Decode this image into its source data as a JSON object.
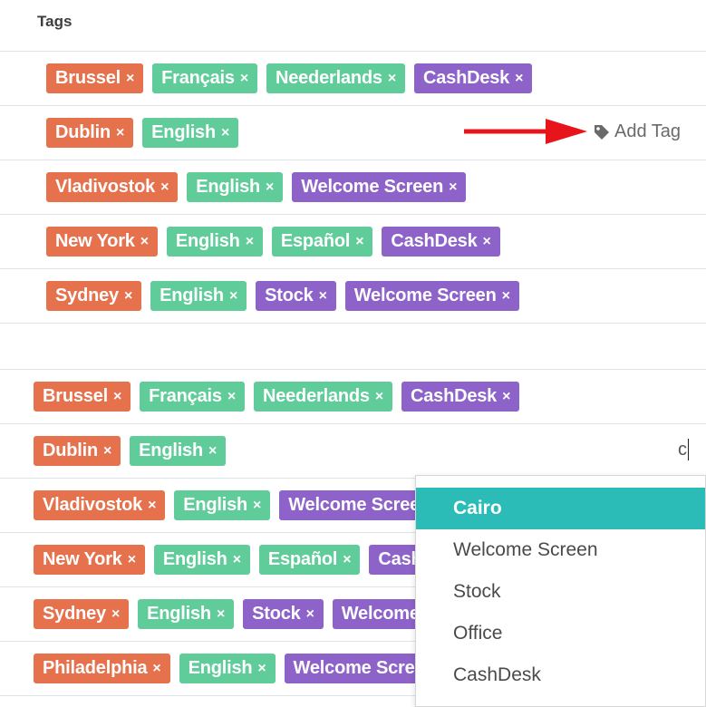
{
  "header": {
    "title": "Tags"
  },
  "top_rows": [
    {
      "tags": [
        {
          "label": "Brussel",
          "x": "×"
        },
        {
          "label": "Français",
          "x": "×"
        },
        {
          "label": "Neederlands",
          "x": "×"
        },
        {
          "label": "CashDesk",
          "x": "×"
        }
      ]
    },
    {
      "tags": [
        {
          "label": "Dublin",
          "x": "×"
        },
        {
          "label": "English",
          "x": "×"
        }
      ]
    },
    {
      "tags": [
        {
          "label": "Vladivostok",
          "x": "×"
        },
        {
          "label": "English",
          "x": "×"
        },
        {
          "label": "Welcome Screen",
          "x": "×"
        }
      ]
    },
    {
      "tags": [
        {
          "label": "New York",
          "x": "×"
        },
        {
          "label": "English",
          "x": "×"
        },
        {
          "label": "Español",
          "x": "×"
        },
        {
          "label": "CashDesk",
          "x": "×"
        }
      ]
    },
    {
      "tags": [
        {
          "label": "Sydney",
          "x": "×"
        },
        {
          "label": "English",
          "x": "×"
        },
        {
          "label": "Stock",
          "x": "×"
        },
        {
          "label": "Welcome Screen",
          "x": "×"
        }
      ]
    }
  ],
  "add_tag": {
    "label": "Add Tag",
    "icon": "tag-icon"
  },
  "bottom_rows": [
    {
      "tags": [
        {
          "label": "Brussel",
          "x": "×"
        },
        {
          "label": "Français",
          "x": "×"
        },
        {
          "label": "Neederlands",
          "x": "×"
        },
        {
          "label": "CashDesk",
          "x": "×"
        }
      ]
    },
    {
      "tags": [
        {
          "label": "Dublin",
          "x": "×"
        },
        {
          "label": "English",
          "x": "×"
        }
      ]
    },
    {
      "tags": [
        {
          "label": "Vladivostok",
          "x": "×"
        },
        {
          "label": "English",
          "x": "×"
        },
        {
          "label": "Welcome Screen",
          "x": "×"
        }
      ]
    },
    {
      "tags": [
        {
          "label": "New York",
          "x": "×"
        },
        {
          "label": "English",
          "x": "×"
        },
        {
          "label": "Español",
          "x": "×"
        },
        {
          "label": "CashDesk",
          "x": "×"
        }
      ]
    },
    {
      "tags": [
        {
          "label": "Sydney",
          "x": "×"
        },
        {
          "label": "English",
          "x": "×"
        },
        {
          "label": "Stock",
          "x": "×"
        },
        {
          "label": "Welcome Screen",
          "x": "×"
        }
      ]
    },
    {
      "tags": [
        {
          "label": "Philadelphia",
          "x": "×"
        },
        {
          "label": "English",
          "x": "×"
        },
        {
          "label": "Welcome Screen",
          "x": "×"
        }
      ]
    }
  ],
  "tag_input": {
    "value": "c"
  },
  "dropdown": {
    "options": [
      {
        "label": "Cairo",
        "active": true
      },
      {
        "label": "Welcome Screen"
      },
      {
        "label": "Stock"
      },
      {
        "label": "Office"
      },
      {
        "label": "CashDesk"
      }
    ]
  },
  "colors": {
    "city": "#e5714d",
    "language": "#5fcc9a",
    "category": "#8d62c9",
    "highlight": "#2cbcb8",
    "arrow": "#e8141b"
  }
}
